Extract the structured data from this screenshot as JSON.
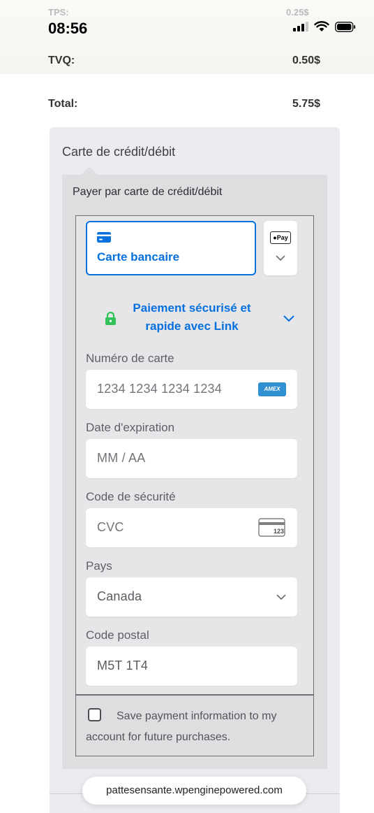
{
  "status_bar": {
    "time": "08:56"
  },
  "order_summary": {
    "tps_label": "TPS:",
    "tps_value": "0.25$",
    "tvq_label": "TVQ:",
    "tvq_value": "0.50$",
    "total_label": "Total:",
    "total_value": "5.75$"
  },
  "payment": {
    "method_title": "Carte de crédit/débit",
    "inner_title": "Payer par carte de crédit/débit",
    "card_tab_label": "Carte bancaire",
    "apple_pay_label": "Pay",
    "link_text": "Paiement sécurisé et rapide avec Link",
    "fields": {
      "card_number_label": "Numéro de carte",
      "card_number_placeholder": "1234 1234 1234 1234",
      "card_brand": "AMEX",
      "expiry_label": "Date d'expiration",
      "expiry_placeholder": "MM / AA",
      "cvc_label": "Code de sécurité",
      "cvc_placeholder": "CVC",
      "cvc_icon_text": "123",
      "country_label": "Pays",
      "country_value": "Canada",
      "postal_label": "Code postal",
      "postal_value": "M5T 1T4"
    },
    "save_info_text": "Save payment information to my account for future purchases."
  },
  "browser": {
    "url": "pattesensante.wpenginepowered.com"
  },
  "colors": {
    "accent": "#0570de",
    "link_lock": "#33c25a",
    "panel_bg": "#edeaf1"
  }
}
